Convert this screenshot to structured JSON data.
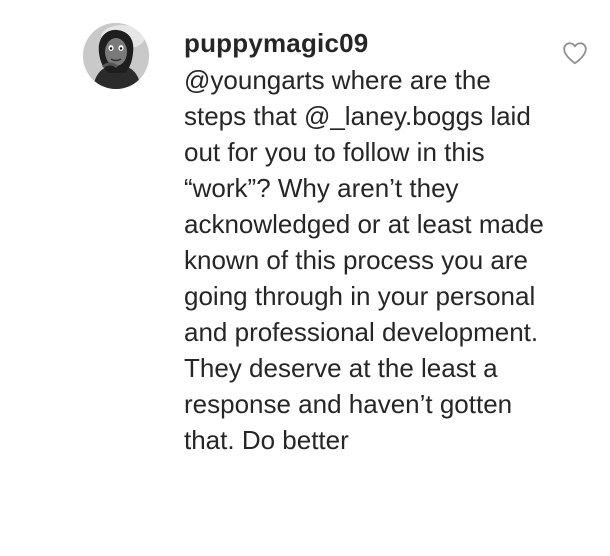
{
  "comment": {
    "username": "puppymagic09",
    "text": "@youngarts where are the steps that @_laney.boggs laid out for you to follow in this “work”? Why aren’t they acknowledged or at least made known of this process you are going through in your personal and professional development. They deserve at the least a response and haven’t gotten that. Do better",
    "avatar_icon": "profile-photo",
    "like_icon": "heart-outline-icon",
    "liked": false
  },
  "colors": {
    "text": "#262626",
    "icon": "#8e8e8e",
    "background": "#ffffff"
  }
}
